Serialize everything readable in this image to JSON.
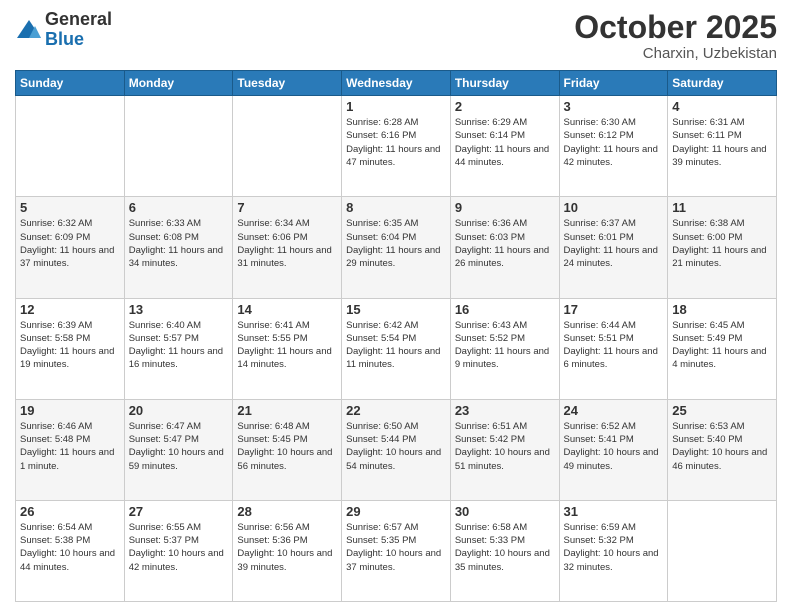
{
  "logo": {
    "general": "General",
    "blue": "Blue"
  },
  "title": "October 2025",
  "location": "Charxin, Uzbekistan",
  "days_header": [
    "Sunday",
    "Monday",
    "Tuesday",
    "Wednesday",
    "Thursday",
    "Friday",
    "Saturday"
  ],
  "weeks": [
    [
      {
        "day": "",
        "info": ""
      },
      {
        "day": "",
        "info": ""
      },
      {
        "day": "",
        "info": ""
      },
      {
        "day": "1",
        "info": "Sunrise: 6:28 AM\nSunset: 6:16 PM\nDaylight: 11 hours and 47 minutes."
      },
      {
        "day": "2",
        "info": "Sunrise: 6:29 AM\nSunset: 6:14 PM\nDaylight: 11 hours and 44 minutes."
      },
      {
        "day": "3",
        "info": "Sunrise: 6:30 AM\nSunset: 6:12 PM\nDaylight: 11 hours and 42 minutes."
      },
      {
        "day": "4",
        "info": "Sunrise: 6:31 AM\nSunset: 6:11 PM\nDaylight: 11 hours and 39 minutes."
      }
    ],
    [
      {
        "day": "5",
        "info": "Sunrise: 6:32 AM\nSunset: 6:09 PM\nDaylight: 11 hours and 37 minutes."
      },
      {
        "day": "6",
        "info": "Sunrise: 6:33 AM\nSunset: 6:08 PM\nDaylight: 11 hours and 34 minutes."
      },
      {
        "day": "7",
        "info": "Sunrise: 6:34 AM\nSunset: 6:06 PM\nDaylight: 11 hours and 31 minutes."
      },
      {
        "day": "8",
        "info": "Sunrise: 6:35 AM\nSunset: 6:04 PM\nDaylight: 11 hours and 29 minutes."
      },
      {
        "day": "9",
        "info": "Sunrise: 6:36 AM\nSunset: 6:03 PM\nDaylight: 11 hours and 26 minutes."
      },
      {
        "day": "10",
        "info": "Sunrise: 6:37 AM\nSunset: 6:01 PM\nDaylight: 11 hours and 24 minutes."
      },
      {
        "day": "11",
        "info": "Sunrise: 6:38 AM\nSunset: 6:00 PM\nDaylight: 11 hours and 21 minutes."
      }
    ],
    [
      {
        "day": "12",
        "info": "Sunrise: 6:39 AM\nSunset: 5:58 PM\nDaylight: 11 hours and 19 minutes."
      },
      {
        "day": "13",
        "info": "Sunrise: 6:40 AM\nSunset: 5:57 PM\nDaylight: 11 hours and 16 minutes."
      },
      {
        "day": "14",
        "info": "Sunrise: 6:41 AM\nSunset: 5:55 PM\nDaylight: 11 hours and 14 minutes."
      },
      {
        "day": "15",
        "info": "Sunrise: 6:42 AM\nSunset: 5:54 PM\nDaylight: 11 hours and 11 minutes."
      },
      {
        "day": "16",
        "info": "Sunrise: 6:43 AM\nSunset: 5:52 PM\nDaylight: 11 hours and 9 minutes."
      },
      {
        "day": "17",
        "info": "Sunrise: 6:44 AM\nSunset: 5:51 PM\nDaylight: 11 hours and 6 minutes."
      },
      {
        "day": "18",
        "info": "Sunrise: 6:45 AM\nSunset: 5:49 PM\nDaylight: 11 hours and 4 minutes."
      }
    ],
    [
      {
        "day": "19",
        "info": "Sunrise: 6:46 AM\nSunset: 5:48 PM\nDaylight: 11 hours and 1 minute."
      },
      {
        "day": "20",
        "info": "Sunrise: 6:47 AM\nSunset: 5:47 PM\nDaylight: 10 hours and 59 minutes."
      },
      {
        "day": "21",
        "info": "Sunrise: 6:48 AM\nSunset: 5:45 PM\nDaylight: 10 hours and 56 minutes."
      },
      {
        "day": "22",
        "info": "Sunrise: 6:50 AM\nSunset: 5:44 PM\nDaylight: 10 hours and 54 minutes."
      },
      {
        "day": "23",
        "info": "Sunrise: 6:51 AM\nSunset: 5:42 PM\nDaylight: 10 hours and 51 minutes."
      },
      {
        "day": "24",
        "info": "Sunrise: 6:52 AM\nSunset: 5:41 PM\nDaylight: 10 hours and 49 minutes."
      },
      {
        "day": "25",
        "info": "Sunrise: 6:53 AM\nSunset: 5:40 PM\nDaylight: 10 hours and 46 minutes."
      }
    ],
    [
      {
        "day": "26",
        "info": "Sunrise: 6:54 AM\nSunset: 5:38 PM\nDaylight: 10 hours and 44 minutes."
      },
      {
        "day": "27",
        "info": "Sunrise: 6:55 AM\nSunset: 5:37 PM\nDaylight: 10 hours and 42 minutes."
      },
      {
        "day": "28",
        "info": "Sunrise: 6:56 AM\nSunset: 5:36 PM\nDaylight: 10 hours and 39 minutes."
      },
      {
        "day": "29",
        "info": "Sunrise: 6:57 AM\nSunset: 5:35 PM\nDaylight: 10 hours and 37 minutes."
      },
      {
        "day": "30",
        "info": "Sunrise: 6:58 AM\nSunset: 5:33 PM\nDaylight: 10 hours and 35 minutes."
      },
      {
        "day": "31",
        "info": "Sunrise: 6:59 AM\nSunset: 5:32 PM\nDaylight: 10 hours and 32 minutes."
      },
      {
        "day": "",
        "info": ""
      }
    ]
  ]
}
